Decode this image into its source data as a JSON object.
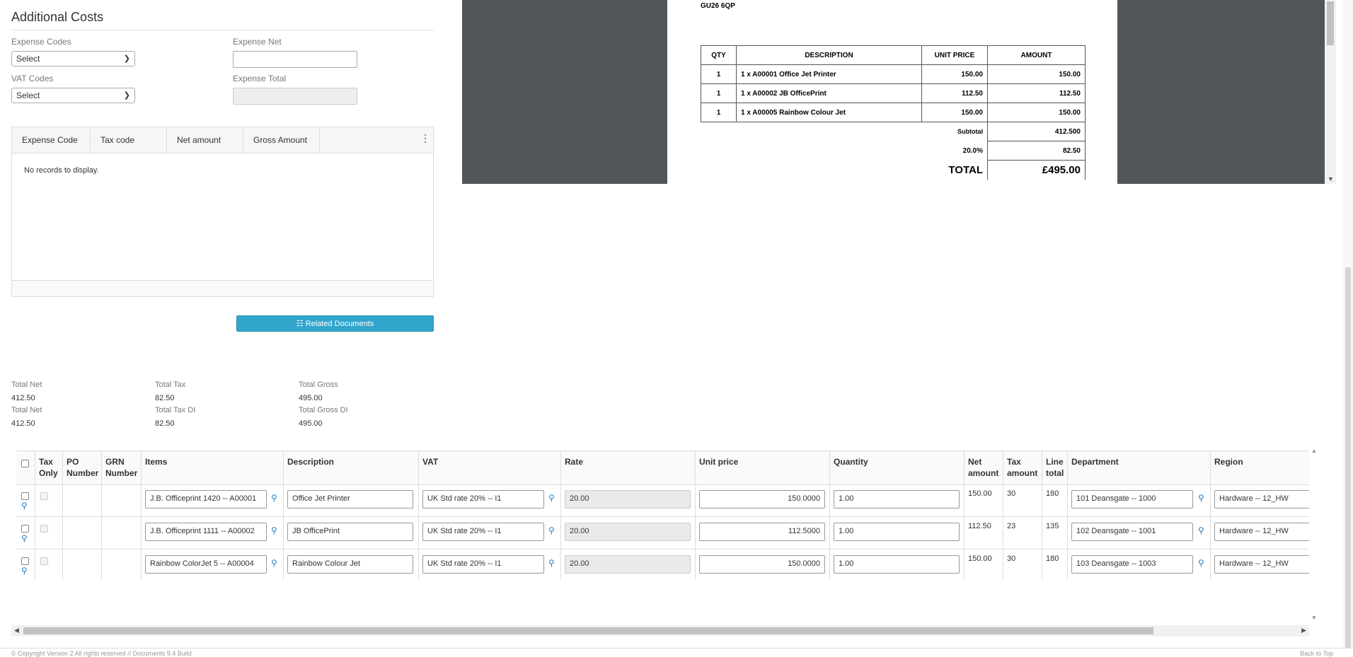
{
  "additional_costs": {
    "title": "Additional Costs",
    "expense_codes_label": "Expense Codes",
    "expense_codes_value": "Select",
    "vat_codes_label": "VAT Codes",
    "vat_codes_value": "Select",
    "expense_net_label": "Expense Net",
    "expense_total_label": "Expense Total",
    "grid_columns": [
      "Expense Code",
      "Tax code",
      "Net amount",
      "Gross Amount"
    ],
    "no_records": "No records to display.",
    "related_documents_label": "Related Documents"
  },
  "invoice_preview": {
    "postcode": "GU26 6QP",
    "headers": [
      "QTY",
      "DESCRIPTION",
      "UNIT PRICE",
      "AMOUNT"
    ],
    "rows": [
      {
        "qty": "1",
        "description": "1 x A00001 Office Jet Printer",
        "unit_price": "150.00",
        "amount": "150.00"
      },
      {
        "qty": "1",
        "description": "1 x A00002 JB OfficePrint",
        "unit_price": "112.50",
        "amount": "112.50"
      },
      {
        "qty": "1",
        "description": "1 x A00005 Rainbow Colour Jet",
        "unit_price": "150.00",
        "amount": "150.00"
      }
    ],
    "subtotal_label": "Subtotal",
    "subtotal_value": "412.500",
    "vat_label": "20.0%",
    "vat_value": "82.50",
    "total_label": "TOTAL",
    "total_value": "£495.00"
  },
  "totals": {
    "row1": [
      {
        "label": "Total Net",
        "value": "412.50"
      },
      {
        "label": "Total Tax",
        "value": "82.50"
      },
      {
        "label": "Total Gross",
        "value": "495.00"
      }
    ],
    "row2": [
      {
        "label": "Total Net",
        "value": "412.50"
      },
      {
        "label": "Total Tax DI",
        "value": "82.50"
      },
      {
        "label": "Total Gross DI",
        "value": "495.00"
      }
    ]
  },
  "lines_grid": {
    "headers": {
      "tax_only": "Tax Only",
      "po_number": "PO Number",
      "grn_number": "GRN Number",
      "items": "Items",
      "description": "Description",
      "vat": "VAT",
      "rate": "Rate",
      "unit_price": "Unit price",
      "quantity": "Quantity",
      "net_amount": "Net amount",
      "tax_amount": "Tax amount",
      "line_total": "Line total",
      "department": "Department",
      "region": "Region"
    },
    "rows": [
      {
        "item": "J.B. Officeprint 1420 -- A00001",
        "description": "Office Jet Printer",
        "vat": "UK Std rate 20% -- I1",
        "rate": "20.00",
        "unit_price": "150.0000",
        "quantity": "1.00",
        "net": "150.00",
        "tax": "30",
        "total": "180",
        "department": "101 Deansgate -- 1000",
        "region": "Hardware -- 12_HW"
      },
      {
        "item": "J.B. Officeprint 1111 -- A00002",
        "description": "JB OfficePrint",
        "vat": "UK Std rate 20% -- I1",
        "rate": "20.00",
        "unit_price": "112.5000",
        "quantity": "1.00",
        "net": "112.50",
        "tax": "23",
        "total": "135",
        "department": "102 Deansgate -- 1001",
        "region": "Hardware -- 12_HW"
      },
      {
        "item": "Rainbow ColorJet 5 -- A00004",
        "description": "Rainbow Colour Jet",
        "vat": "UK Std rate 20% -- I1",
        "rate": "20.00",
        "unit_price": "150.0000",
        "quantity": "1.00",
        "net": "150.00",
        "tax": "30",
        "total": "180",
        "department": "103 Deansgate -- 1003",
        "region": "Hardware -- 12_HW"
      }
    ]
  },
  "footer": {
    "copyright": "© Copyright Version 2 All rights reserved // Documents 9.4 Build",
    "back_to_top": "Back to Top"
  }
}
